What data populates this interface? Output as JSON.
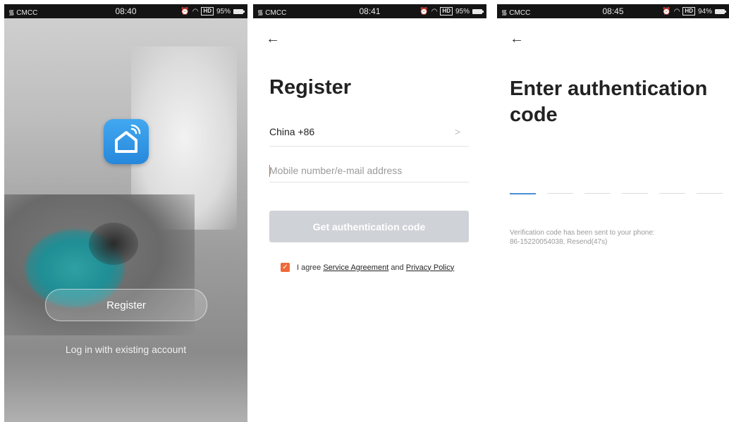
{
  "screens": [
    {
      "status": {
        "carrier": "CMCC",
        "time": "08:40",
        "hd": "HD",
        "battery": "95%"
      },
      "register_label": "Register",
      "login_label": "Log in with existing account",
      "icons": [
        "home-wifi-icon"
      ]
    },
    {
      "status": {
        "carrier": "CMCC",
        "time": "08:41",
        "hd": "HD",
        "battery": "95%"
      },
      "back_icon": "arrow-left-icon",
      "title": "Register",
      "country": "China +86",
      "phone_placeholder": "Mobile number/e-mail address",
      "get_code_label": "Get authentication code",
      "agree_prefix": "I agree",
      "service_agreement": "Service Agreement",
      "and_text": "and",
      "privacy_policy": "Privacy Policy",
      "checkbox_checked": true
    },
    {
      "status": {
        "carrier": "CMCC",
        "time": "08:45",
        "hd": "HD",
        "battery": "94%"
      },
      "back_icon": "arrow-left-icon",
      "title": "Enter authentication code",
      "code_slots": 6,
      "sent_line1": "Verification code has been sent to your phone:",
      "sent_line2": "86-15220054038, Resend(47s)"
    }
  ],
  "colors": {
    "accent": "#ee6a3a",
    "app_icon": "#2f94e6",
    "disabled_button": "#cfd2d7",
    "active_slot": "#4a8fd4"
  }
}
